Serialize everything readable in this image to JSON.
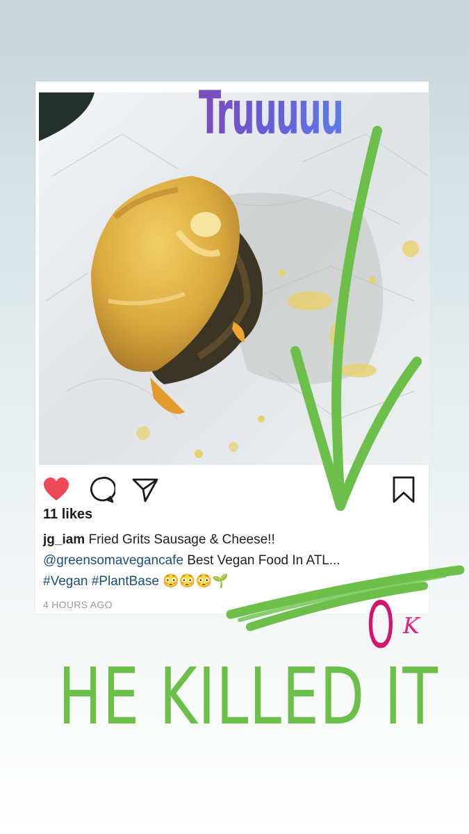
{
  "post": {
    "likes": "11 likes",
    "username": "jg_iam",
    "caption_text": " Fried Grits Sausage & Cheese!!",
    "mention": "@greensomavegancafe",
    "caption_line2": " Best Vegan Food In ATL...",
    "hashtags": "#Vegan #PlantBase",
    "emojis": "😳😳😳🌱",
    "timestamp": "4 HOURS AGO",
    "liked": true
  },
  "icons": {
    "like": "heart-icon",
    "comment": "comment-icon",
    "share": "paper-plane-icon",
    "save": "bookmark-icon"
  },
  "overlays": {
    "sticker_text": "Truuuuu",
    "ok_o": "O",
    "ok_k": "K",
    "headline": "HE KILLED IT"
  },
  "colors": {
    "like_red": "#ed4956",
    "link_blue": "#1d4f7a",
    "arrow_green": "#6cc04a",
    "ok_pink": "#d4156d",
    "sticker_purple": "#7b4cb8"
  }
}
